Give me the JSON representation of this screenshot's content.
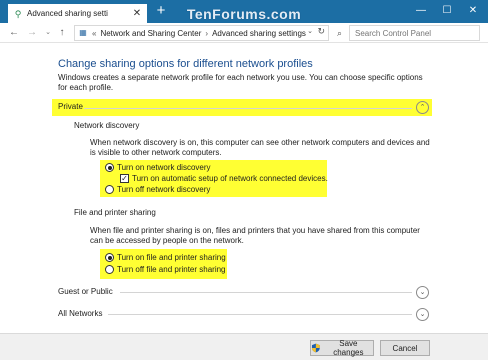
{
  "tab": {
    "title": "Advanced sharing setti",
    "close": "✕",
    "new_tab": "+"
  },
  "watermark": "TenForums.com",
  "window_controls": {
    "minimize": "—",
    "maximize": "☐",
    "close": "✕"
  },
  "address": {
    "back": "←",
    "forward": "→",
    "up": "↑",
    "separator": "«",
    "crumbs": [
      "Network and Sharing Center",
      "Advanced sharing settings"
    ],
    "crumb_sep": "›",
    "dropdown": "⌄",
    "refresh": "↻"
  },
  "search": {
    "placeholder": "Search Control Panel"
  },
  "page": {
    "title": "Change sharing options for different network profiles",
    "description": "Windows creates a separate network profile for each network you use. You can choose specific options for each profile."
  },
  "sections": {
    "private": {
      "label": "Private",
      "chevron": "⌃"
    },
    "guest": {
      "label": "Guest or Public",
      "chevron": "⌄"
    },
    "all": {
      "label": "All Networks",
      "chevron": "⌄"
    }
  },
  "network_discovery": {
    "header": "Network discovery",
    "description": "When network discovery is on, this computer can see other network computers and devices and is visible to other network computers.",
    "on_label": "Turn on network discovery",
    "auto_label": "Turn on automatic setup of network connected devices.",
    "off_label": "Turn off network discovery",
    "selected": "on",
    "auto_checked": true,
    "check_mark": "✓"
  },
  "file_sharing": {
    "header": "File and printer sharing",
    "description": "When file and printer sharing is on, files and printers that you have shared from this computer can be accessed by people on the network.",
    "on_label": "Turn on file and printer sharing",
    "off_label": "Turn off file and printer sharing",
    "selected": "on"
  },
  "footer": {
    "save_label": "Save changes",
    "cancel_label": "Cancel"
  },
  "colors": {
    "titlebar": "#1c6ea4",
    "highlight": "#ffff33",
    "title_text": "#1a4e8f"
  }
}
